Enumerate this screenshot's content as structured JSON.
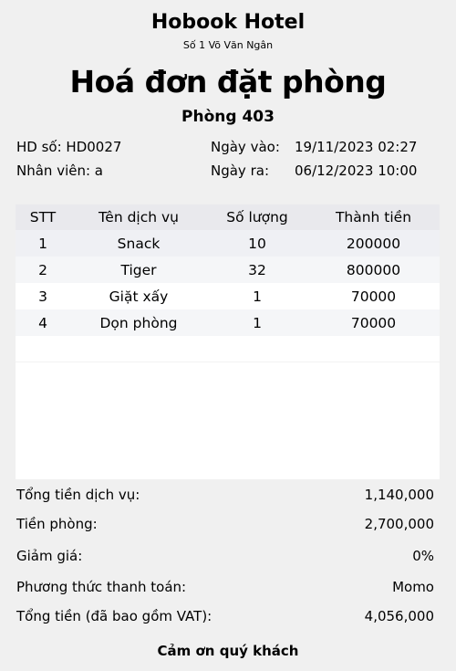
{
  "header": {
    "hotel_name": "Hobook Hotel",
    "address": "Số 1 Võ Văn Ngân",
    "title": "Hoá đơn đặt phòng",
    "room": "Phòng 403"
  },
  "info": {
    "invoice": "HD số: HD0027",
    "staff": "Nhân viên: a",
    "checkin_label": "Ngày vào:",
    "checkin_value": "19/11/2023 02:27",
    "checkout_label": "Ngày ra:",
    "checkout_value": "06/12/2023 10:00"
  },
  "table": {
    "headers": [
      "STT",
      "Tên dịch vụ",
      "Số lượng",
      "Thành tiền"
    ],
    "rows": [
      [
        "1",
        "Snack",
        "10",
        "200000"
      ],
      [
        "2",
        "Tiger",
        "32",
        "800000"
      ],
      [
        "3",
        "Giặt xấy",
        "1",
        "70000"
      ],
      [
        "4",
        "Dọn phòng",
        "1",
        "70000"
      ]
    ]
  },
  "summary": [
    {
      "label": "Tổng tiền dịch vụ:",
      "value": "1,140,000"
    },
    {
      "label": "Tiền phòng:",
      "value": "2,700,000"
    },
    {
      "label": "Giảm giá:",
      "value": "0%"
    },
    {
      "label": "Phương thức thanh toán:",
      "value": "Momo"
    },
    {
      "label": "Tổng tiền (đã bao gồm VAT):",
      "value": "4,056,000"
    }
  ],
  "footer": {
    "thanks": "Cảm ơn quý khách"
  }
}
